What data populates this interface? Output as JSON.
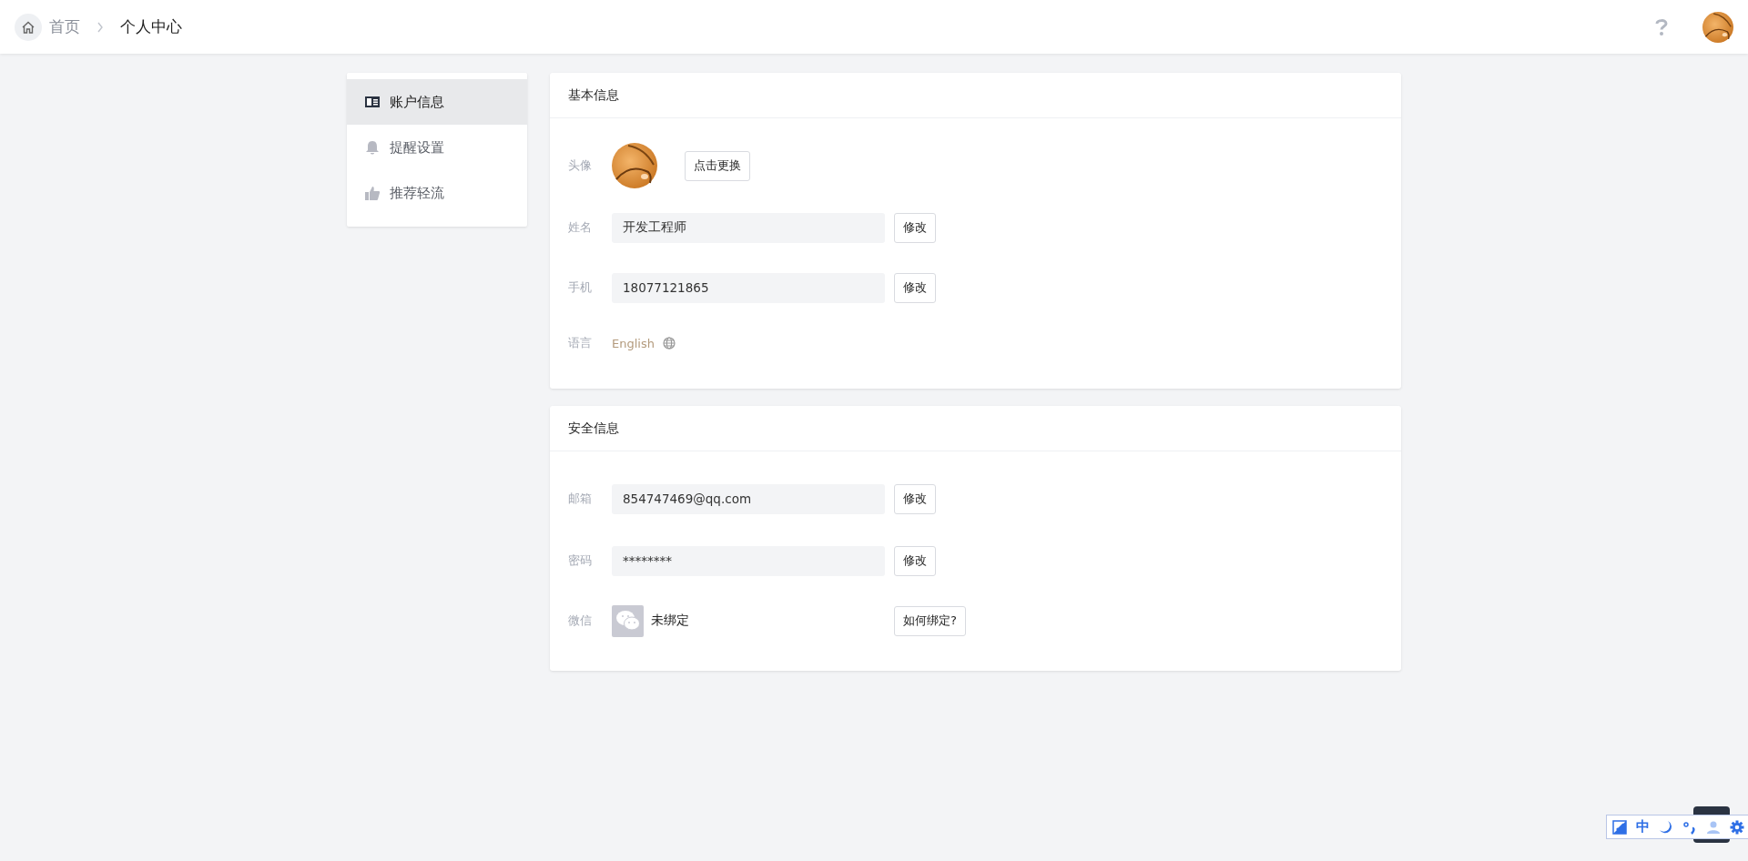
{
  "breadcrumb": [
    {
      "label": "首页"
    },
    {
      "label": "个人中心"
    }
  ],
  "sidebar": {
    "items": [
      {
        "label": "账户信息",
        "selected": true
      },
      {
        "label": "提醒设置",
        "selected": false
      },
      {
        "label": "推荐轻流",
        "selected": false
      }
    ]
  },
  "sections": [
    {
      "title": "基本信息",
      "rows": [
        {
          "kind": "avatar",
          "label": "头像",
          "button": "点击更换"
        },
        {
          "kind": "field",
          "label": "姓名",
          "value": "开发工程师",
          "button": "修改"
        },
        {
          "kind": "field",
          "label": "手机",
          "value": "18077121865",
          "button": "修改"
        },
        {
          "kind": "language",
          "label": "语言",
          "value": "English"
        }
      ]
    },
    {
      "title": "安全信息",
      "rows": [
        {
          "kind": "field",
          "label": "邮箱",
          "value": "854747469@qq.com",
          "button": "修改"
        },
        {
          "kind": "field",
          "label": "密码",
          "value": "********",
          "button": "修改"
        },
        {
          "kind": "wechat",
          "label": "微信",
          "value": "未绑定",
          "button": "如何绑定?"
        }
      ]
    }
  ],
  "ime_toolbar": {
    "mode": "中"
  }
}
